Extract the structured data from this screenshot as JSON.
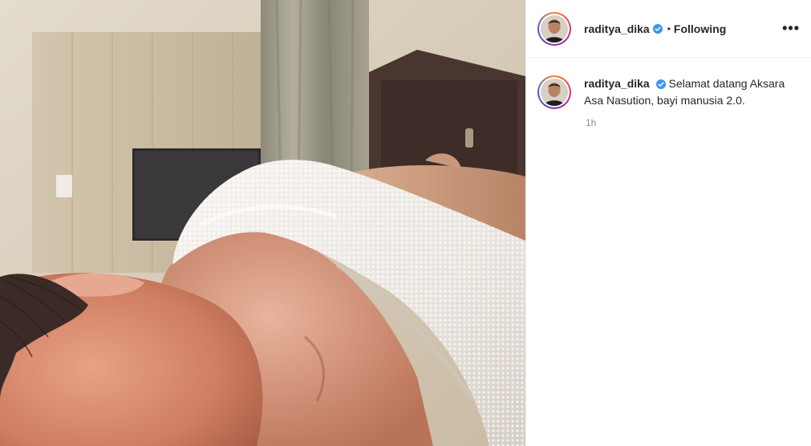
{
  "post": {
    "photo_alt": "newborn baby wrapped in white towel"
  },
  "header": {
    "username": "raditya_dika",
    "separator": "•",
    "follow_status": "Following",
    "more_label": "•••"
  },
  "caption": {
    "username": "raditya_dika",
    "text": "Selamat datang Aksara Asa Nasution, bayi manusia 2.0.",
    "timestamp": "1h"
  },
  "icons": {
    "verified": "verified-badge-icon",
    "more": "more-options-icon"
  },
  "colors": {
    "verified_blue": "#3897f0",
    "story_ring_start": "#f58529",
    "story_ring_end": "#515bd4",
    "timestamp_gray": "#8e8e8e"
  }
}
